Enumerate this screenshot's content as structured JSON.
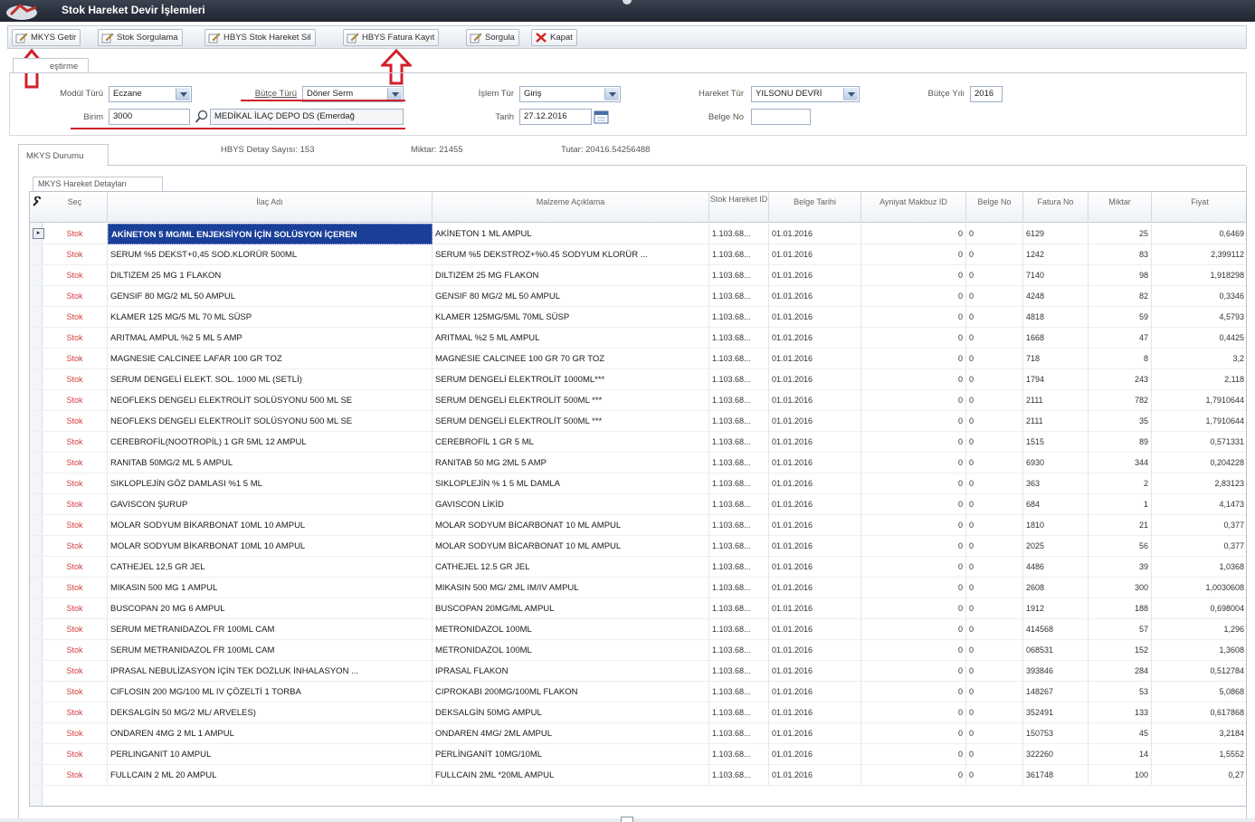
{
  "window": {
    "title": "Stok Hareket Devir İşlemleri"
  },
  "toolbar": {
    "buttons": [
      {
        "label": "MKYS Getir"
      },
      {
        "label": "Stok Sorgulama"
      },
      {
        "label": "HBYS Stok Hareket Sil"
      },
      {
        "label": "HBYS Fatura Kayıt"
      },
      {
        "label": "Sorgula"
      },
      {
        "label": "Kapat"
      }
    ]
  },
  "filter": {
    "tab_label": "eştirme",
    "modul_turu": {
      "label": "Modül Türü",
      "value": "Eczane"
    },
    "butce_turu": {
      "label": "Bütçe Türü",
      "value": "Döner Serm"
    },
    "birim": {
      "label": "Birim",
      "value": "3000",
      "desc": "MEDİKAL İLAÇ DEPO DS (Emerdağ"
    },
    "islem_turu": {
      "label": "İşlem Tür",
      "value": "Giriş"
    },
    "tarih": {
      "label": "Tarih",
      "value": "27.12.2016"
    },
    "hareket_turu": {
      "label": "Hareket Tür",
      "value": "YILSONU DEVRİ"
    },
    "belge_no": {
      "label": "Belge No",
      "value": ""
    },
    "butce_yili": {
      "label": "Bütçe Yılı",
      "value": "2016"
    }
  },
  "status": {
    "tab_label": "MKYS Durumu",
    "hbys_detay": "HBYS Detay Sayısı: 153",
    "miktar": "Miktar: 21455",
    "tutar": "Tutar: 20416.54256488"
  },
  "grid": {
    "tab_label": "MKYS Hareket Detayları",
    "columns": [
      "Seç",
      "İlaç Adı",
      "Malzeme Açıklama",
      "Stok Hareket ID",
      "Belge Tarihi",
      "Ayniyat Makbuz ID",
      "Belge No",
      "Fatura No",
      "Miktar",
      "Fiyat"
    ],
    "rows": [
      {
        "sec": "Stok",
        "ilac": "AKİNETON 5 MG/ML ENJEKSİYON İÇİN SOLÜSYON İÇEREN",
        "malzeme": "AKİNETON 1 ML AMPUL",
        "stok": "1.103.68...",
        "tarih": "01.01.2016",
        "ayniyat": "0",
        "belge": "0",
        "fatura": "6129",
        "miktar": "25",
        "fiyat": "0,6469"
      },
      {
        "sec": "Stok",
        "ilac": "SERUM %5 DEKST+0,45 SOD.KLORÜR 500ML",
        "malzeme": "SERUM %5 DEKSTROZ+%0.45 SODYUM KLORÜR ...",
        "stok": "1.103.68...",
        "tarih": "01.01.2016",
        "ayniyat": "0",
        "belge": "0",
        "fatura": "1242",
        "miktar": "83",
        "fiyat": "2,399112"
      },
      {
        "sec": "Stok",
        "ilac": "DILTIZEM 25 MG 1 FLAKON",
        "malzeme": "DILTIZEM 25 MG FLAKON",
        "stok": "1.103.68...",
        "tarih": "01.01.2016",
        "ayniyat": "0",
        "belge": "0",
        "fatura": "7140",
        "miktar": "98",
        "fiyat": "1,918298"
      },
      {
        "sec": "Stok",
        "ilac": "GENSIF 80 MG/2 ML 50 AMPUL",
        "malzeme": "GENSIF 80 MG/2 ML 50 AMPUL",
        "stok": "1.103.68...",
        "tarih": "01.01.2016",
        "ayniyat": "0",
        "belge": "0",
        "fatura": "4248",
        "miktar": "82",
        "fiyat": "0,3346"
      },
      {
        "sec": "Stok",
        "ilac": "KLAMER 125 MG/5 ML 70 ML SÜSP",
        "malzeme": "KLAMER 125MG/5ML 70ML SÜSP",
        "stok": "1.103.68...",
        "tarih": "01.01.2016",
        "ayniyat": "0",
        "belge": "0",
        "fatura": "4818",
        "miktar": "59",
        "fiyat": "4,5793"
      },
      {
        "sec": "Stok",
        "ilac": "ARITMAL AMPUL %2 5 ML 5 AMP",
        "malzeme": "ARITMAL %2 5 ML AMPUL",
        "stok": "1.103.68...",
        "tarih": "01.01.2016",
        "ayniyat": "0",
        "belge": "0",
        "fatura": "1668",
        "miktar": "47",
        "fiyat": "0,4425"
      },
      {
        "sec": "Stok",
        "ilac": "MAGNESIE CALCINEE LAFAR 100 GR TOZ",
        "malzeme": "MAGNESIE CALCINEE 100 GR 70 GR TOZ",
        "stok": "1.103.68...",
        "tarih": "01.01.2016",
        "ayniyat": "0",
        "belge": "0",
        "fatura": "718",
        "miktar": "8",
        "fiyat": "3,2"
      },
      {
        "sec": "Stok",
        "ilac": "SERUM DENGELİ ELEKT. SOL. 1000 ML (SETLİ)",
        "malzeme": "SERUM DENGELİ ELEKTROLİT 1000ML***",
        "stok": "1.103.68...",
        "tarih": "01.01.2016",
        "ayniyat": "0",
        "belge": "0",
        "fatura": "1794",
        "miktar": "243",
        "fiyat": "2,118"
      },
      {
        "sec": "Stok",
        "ilac": "NEOFLEKS DENGELI ELEKTROLİT SOLÜSYONU 500 ML SE",
        "malzeme": "SERUM DENGELİ ELEKTROLİT 500ML ***",
        "stok": "1.103.68...",
        "tarih": "01.01.2016",
        "ayniyat": "0",
        "belge": "0",
        "fatura": "2111",
        "miktar": "782",
        "fiyat": "1,7910644"
      },
      {
        "sec": "Stok",
        "ilac": "NEOFLEKS DENGELI ELEKTROLİT SOLÜSYONU 500 ML SE",
        "malzeme": "SERUM DENGELİ ELEKTROLİT 500ML ***",
        "stok": "1.103.68...",
        "tarih": "01.01.2016",
        "ayniyat": "0",
        "belge": "0",
        "fatura": "2111",
        "miktar": "35",
        "fiyat": "1,7910644"
      },
      {
        "sec": "Stok",
        "ilac": "CEREBROFİL(NOOTROPİL) 1 GR 5ML 12 AMPUL",
        "malzeme": "CEREBROFİL 1 GR 5 ML",
        "stok": "1.103.68...",
        "tarih": "01.01.2016",
        "ayniyat": "0",
        "belge": "0",
        "fatura": "1515",
        "miktar": "89",
        "fiyat": "0,571331"
      },
      {
        "sec": "Stok",
        "ilac": "RANITAB 50MG/2 ML 5 AMPUL",
        "malzeme": "RANITAB 50 MG 2ML 5 AMP",
        "stok": "1.103.68...",
        "tarih": "01.01.2016",
        "ayniyat": "0",
        "belge": "0",
        "fatura": "6930",
        "miktar": "344",
        "fiyat": "0,204228"
      },
      {
        "sec": "Stok",
        "ilac": "SIKLOPLEJİN GÖZ DAMLASI %1 5 ML",
        "malzeme": "SIKLOPLEJİN % 1 5 ML DAMLA",
        "stok": "1.103.68...",
        "tarih": "01.01.2016",
        "ayniyat": "0",
        "belge": "0",
        "fatura": "363",
        "miktar": "2",
        "fiyat": "2,83123"
      },
      {
        "sec": "Stok",
        "ilac": "GAVISCON ŞURUP",
        "malzeme": "GAVISCON LİKİD",
        "stok": "1.103.68...",
        "tarih": "01.01.2016",
        "ayniyat": "0",
        "belge": "0",
        "fatura": "684",
        "miktar": "1",
        "fiyat": "4,1473"
      },
      {
        "sec": "Stok",
        "ilac": "MOLAR SODYUM BİKARBONAT 10ML 10 AMPUL",
        "malzeme": "MOLAR SODYUM BİCARBONAT 10 ML AMPUL",
        "stok": "1.103.68...",
        "tarih": "01.01.2016",
        "ayniyat": "0",
        "belge": "0",
        "fatura": "1810",
        "miktar": "21",
        "fiyat": "0,377"
      },
      {
        "sec": "Stok",
        "ilac": "MOLAR SODYUM BİKARBONAT 10ML 10 AMPUL",
        "malzeme": "MOLAR SODYUM BİCARBONAT 10 ML AMPUL",
        "stok": "1.103.68...",
        "tarih": "01.01.2016",
        "ayniyat": "0",
        "belge": "0",
        "fatura": "2025",
        "miktar": "56",
        "fiyat": "0,377"
      },
      {
        "sec": "Stok",
        "ilac": "CATHEJEL 12,5 GR JEL",
        "malzeme": "CATHEJEL 12.5 GR JEL",
        "stok": "1.103.68...",
        "tarih": "01.01.2016",
        "ayniyat": "0",
        "belge": "0",
        "fatura": "4486",
        "miktar": "39",
        "fiyat": "1,0368"
      },
      {
        "sec": "Stok",
        "ilac": "MIKASIN 500 MG 1 AMPUL",
        "malzeme": "MIKASIN 500 MG/ 2ML IM/IV AMPUL",
        "stok": "1.103.68...",
        "tarih": "01.01.2016",
        "ayniyat": "0",
        "belge": "0",
        "fatura": "2608",
        "miktar": "300",
        "fiyat": "1,0030608"
      },
      {
        "sec": "Stok",
        "ilac": "BUSCOPAN 20 MG 6 AMPUL",
        "malzeme": "BUSCOPAN 20MG/ML AMPUL",
        "stok": "1.103.68...",
        "tarih": "01.01.2016",
        "ayniyat": "0",
        "belge": "0",
        "fatura": "1912",
        "miktar": "188",
        "fiyat": "0,698004"
      },
      {
        "sec": "Stok",
        "ilac": "SERUM METRANIDAZOL FR 100ML CAM",
        "malzeme": "METRONIDAZOL 100ML",
        "stok": "1.103.68...",
        "tarih": "01.01.2016",
        "ayniyat": "0",
        "belge": "0",
        "fatura": "414568",
        "miktar": "57",
        "fiyat": "1,296"
      },
      {
        "sec": "Stok",
        "ilac": "SERUM METRANIDAZOL FR 100ML CAM",
        "malzeme": "METRONIDAZOL 100ML",
        "stok": "1.103.68...",
        "tarih": "01.01.2016",
        "ayniyat": "0",
        "belge": "0",
        "fatura": "068531",
        "miktar": "152",
        "fiyat": "1,3608"
      },
      {
        "sec": "Stok",
        "ilac": "IPRASAL NEBULİZASYON İÇİN TEK DOZLUK İNHALASYON ...",
        "malzeme": "IPRASAL FLAKON",
        "stok": "1.103.68...",
        "tarih": "01.01.2016",
        "ayniyat": "0",
        "belge": "0",
        "fatura": "393846",
        "miktar": "284",
        "fiyat": "0,512784"
      },
      {
        "sec": "Stok",
        "ilac": "CIFLOSIN 200 MG/100 ML IV ÇÖZELTİ 1 TORBA",
        "malzeme": "CIPROKABI 200MG/100ML FLAKON",
        "stok": "1.103.68...",
        "tarih": "01.01.2016",
        "ayniyat": "0",
        "belge": "0",
        "fatura": "148267",
        "miktar": "53",
        "fiyat": "5,0868"
      },
      {
        "sec": "Stok",
        "ilac": "DEKSALGİN 50 MG/2 ML/ ARVELES)",
        "malzeme": "DEKSALGİN 50MG AMPUL",
        "stok": "1.103.68...",
        "tarih": "01.01.2016",
        "ayniyat": "0",
        "belge": "0",
        "fatura": "352491",
        "miktar": "133",
        "fiyat": "0,617868"
      },
      {
        "sec": "Stok",
        "ilac": "ONDAREN 4MG 2 ML 1 AMPUL",
        "malzeme": "ONDAREN 4MG/ 2ML AMPUL",
        "stok": "1.103.68...",
        "tarih": "01.01.2016",
        "ayniyat": "0",
        "belge": "0",
        "fatura": "150753",
        "miktar": "45",
        "fiyat": "3,2184"
      },
      {
        "sec": "Stok",
        "ilac": "PERLINGANIT 10 AMPUL",
        "malzeme": "PERLİNGANİT 10MG/10ML",
        "stok": "1.103.68...",
        "tarih": "01.01.2016",
        "ayniyat": "0",
        "belge": "0",
        "fatura": "322260",
        "miktar": "14",
        "fiyat": "1,5552"
      },
      {
        "sec": "Stok",
        "ilac": "FULLCAIN 2 ML 20 AMPUL",
        "malzeme": "FULLCAIN 2ML *20ML AMPUL",
        "stok": "1.103.68...",
        "tarih": "01.01.2016",
        "ayniyat": "0",
        "belge": "0",
        "fatura": "361748",
        "miktar": "100",
        "fiyat": "0,27"
      }
    ]
  }
}
